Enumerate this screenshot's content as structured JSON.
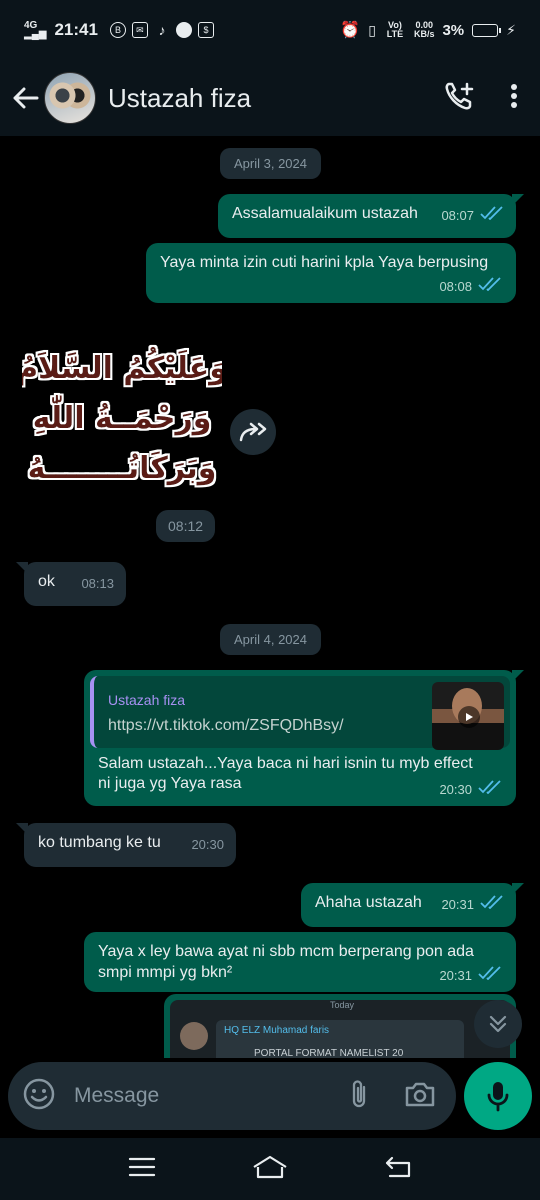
{
  "status_bar": {
    "network": "4G",
    "time": "21:41",
    "app_icons": [
      "b-icon",
      "mail-icon",
      "tiktok-icon",
      "chat-icon",
      "shop-icon"
    ],
    "volte": "Vo) LTE",
    "speed_top": "0.00",
    "speed_unit": "KB/s",
    "battery": "3%"
  },
  "header": {
    "contact_name": "Ustazah fiza"
  },
  "messages": {
    "date1": "April 3, 2024",
    "m1": {
      "text": "Assalamualaikum ustazah",
      "time": "08:07"
    },
    "m2": {
      "text": "Yaya minta izin cuti harini kpla Yaya berpusing",
      "time": "08:08"
    },
    "sticker": {
      "line1": "وَعَلَيْكُمُ السَّلاَمُ",
      "line2": "وَرَحْمَــةُ اللّٰهِ",
      "line3": "وَبَرَكَاتُــــــــهُ",
      "time": "08:12"
    },
    "m3": {
      "text": "ok",
      "time": "08:13"
    },
    "date2": "April 4, 2024",
    "m4": {
      "quote_author": "Ustazah fiza",
      "quote_text": "https://vt.tiktok.com/ZSFQDhBsy/",
      "text": "Salam ustazah...Yaya baca ni hari isnin tu myb effect ni juga yg Yaya rasa",
      "time": "20:30"
    },
    "m5": {
      "text": "ko tumbang ke tu",
      "time": "20:30"
    },
    "m6": {
      "text": "Ahaha ustazah",
      "time": "20:31"
    },
    "m7": {
      "text": "Yaya x ley bawa ayat ni sbb mcm berperang pon ada smpi mmpi yg bkn²",
      "time": "20:31"
    },
    "partial": {
      "day": "Today",
      "name": "HQ ELZ Muhamad faris",
      "text": "PORTAL FORMAT NAMELIST 20"
    }
  },
  "input": {
    "placeholder": "Message"
  },
  "colors": {
    "outgoing_bubble": "#005c4b",
    "incoming_bubble": "#1f2c34",
    "background": "#000000",
    "accent": "#00a884",
    "read_tick": "#53bdeb"
  }
}
